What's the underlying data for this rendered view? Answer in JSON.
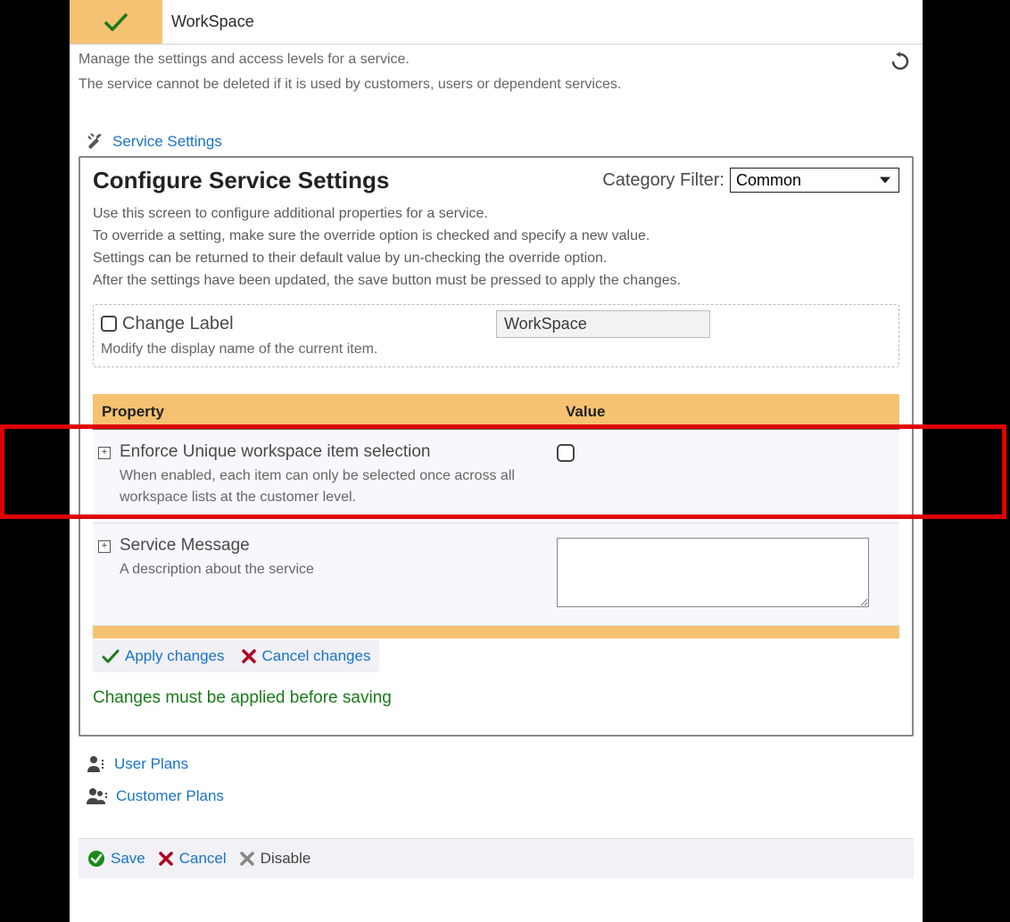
{
  "tab": {
    "title": "WorkSpace"
  },
  "header": {
    "line1": "Manage the settings and access levels for a service.",
    "line2": "The service cannot be deleted if it is used by customers, users or dependent services."
  },
  "sections": {
    "serviceSettingsLink": "Service Settings",
    "userPlansLink": "User Plans",
    "customerPlansLink": "Customer Plans"
  },
  "panel": {
    "title": "Configure Service Settings",
    "filterLabel": "Category Filter:",
    "filterValue": "Common",
    "desc1": "Use this screen to configure additional properties for a service.",
    "desc2": "To override a setting, make sure the override option is checked and specify a new value.",
    "desc3": "Settings can be returned to their default value by un-checking the override option.",
    "desc4": "After the settings have been updated, the save button must be pressed to apply the changes."
  },
  "changeLabel": {
    "title": "Change Label",
    "desc": "Modify the display name of the current item.",
    "value": "WorkSpace"
  },
  "table": {
    "hProperty": "Property",
    "hValue": "Value",
    "rows": [
      {
        "name": "Enforce Unique workspace item selection",
        "desc": "When enabled, each item can only be selected once across all workspace lists at the customer level.",
        "valueType": "checkbox"
      },
      {
        "name": "Service Message",
        "desc": "A description about the service",
        "valueType": "textarea"
      }
    ]
  },
  "actions": {
    "apply": "Apply changes",
    "cancel": "Cancel changes",
    "status": "Changes must be applied before saving"
  },
  "footer": {
    "save": "Save",
    "cancel": "Cancel",
    "disable": "Disable"
  }
}
